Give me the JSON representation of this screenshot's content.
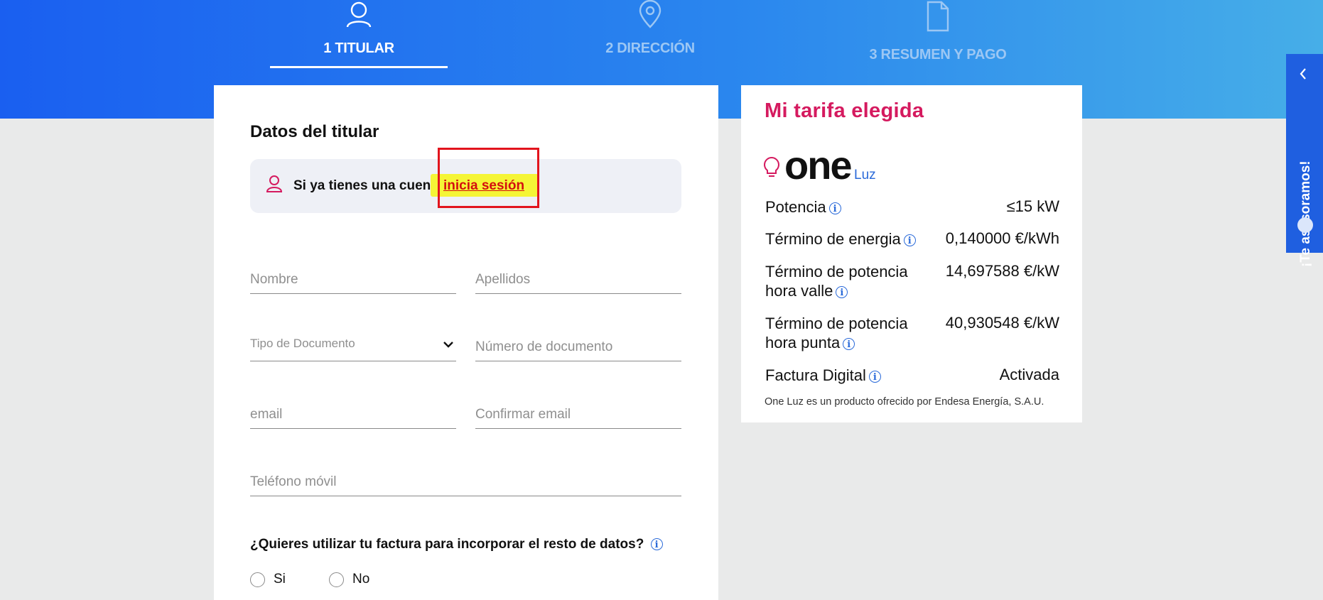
{
  "steps": [
    {
      "label": "1 TITULAR",
      "icon": "user-icon",
      "active": true
    },
    {
      "label": "2 DIRECCIÓN",
      "icon": "location-pin-icon",
      "active": false
    },
    {
      "label": "3 RESUMEN Y PAGO",
      "icon": "document-icon",
      "active": false
    }
  ],
  "form": {
    "title": "Datos del titular",
    "login_prompt": "Si ya tienes una cuenta",
    "login_link": "inicia sesión",
    "fields": {
      "nombre": {
        "placeholder": "Nombre",
        "value": ""
      },
      "apellidos": {
        "placeholder": "Apellidos",
        "value": ""
      },
      "tipo_documento": {
        "placeholder": "Tipo de Documento"
      },
      "numero_documento": {
        "placeholder": "Número de documento",
        "value": ""
      },
      "email": {
        "placeholder": "email",
        "value": ""
      },
      "confirmar_email": {
        "placeholder": "Confirmar email",
        "value": ""
      },
      "telefono": {
        "placeholder": "Teléfono móvil",
        "value": ""
      }
    },
    "question": "¿Quieres utilizar tu factura para incorporar el resto de datos?",
    "options": [
      "Si",
      "No"
    ]
  },
  "tariff": {
    "title": "Mi tarifa elegida",
    "brand": "one",
    "brand_sub": "Luz",
    "rows": [
      {
        "label": "Potencia",
        "value": "≤15 kW",
        "info": true
      },
      {
        "label": "Término de energia",
        "value": "0,140000 €/kWh",
        "info": true
      },
      {
        "label": "Término de potencia hora valle",
        "value": "14,697588 €/kW",
        "info": true
      },
      {
        "label": "Término de potencia hora punta",
        "value": "40,930548 €/kW",
        "info": true
      },
      {
        "label": "Factura Digital",
        "value": "Activada",
        "info": true
      }
    ],
    "footnote": "One Luz es un producto ofrecido por Endesa Energía, S.A.U."
  },
  "side_tab": {
    "label": "¡Te asesoramos!"
  },
  "colors": {
    "brand_blue": "#1a5ff0",
    "accent_pink": "#d51a5f",
    "link_red": "#d40f0f",
    "highlight_yellow": "#f5f536"
  }
}
